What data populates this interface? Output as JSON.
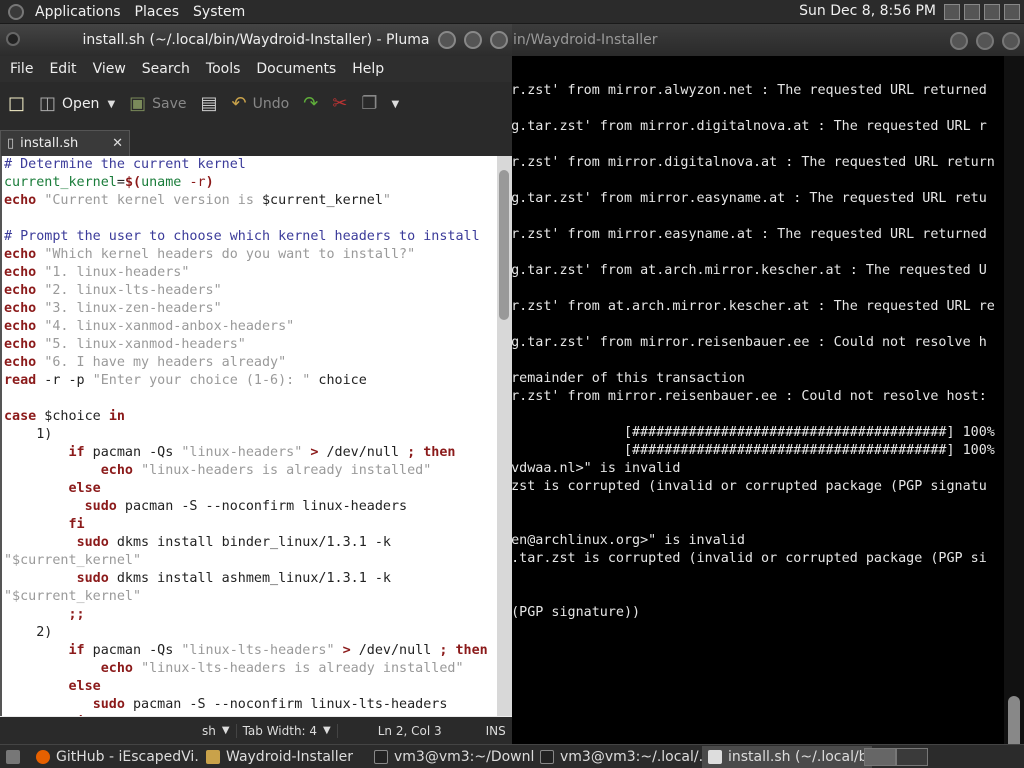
{
  "topbar": {
    "menus": [
      "Applications",
      "Places",
      "System"
    ],
    "clock": "Sun Dec  8,  8:56 PM"
  },
  "terminal": {
    "title": "in/Waydroid-Installer",
    "lines": [
      "tar.zst' from mirror.alwyzon.net : The requested URL returned",
      "",
      "pkg.tar.zst' from mirror.digitalnova.at : The requested URL r",
      "",
      "tar.zst' from mirror.digitalnova.at : The requested URL return",
      "",
      "pkg.tar.zst' from mirror.easyname.at : The requested URL retu",
      "",
      "tar.zst' from mirror.easyname.at : The requested URL returned",
      "",
      "pkg.tar.zst' from at.arch.mirror.kescher.at : The requested U",
      "",
      "tar.zst' from at.arch.mirror.kescher.at : The requested URL re",
      "",
      "pkg.tar.zst' from mirror.reisenbauer.ee : Could not resolve h",
      "",
      "e remainder of this transaction",
      "tar.zst' from mirror.reisenbauer.ee : Could not resolve host:",
      "",
      "                [#######################################] 100%",
      "                [#######################################] 100%",
      "e@vdwaa.nl>\" is invalid",
      "r.zst is corrupted (invalid or corrupted package (PGP signatu",
      "",
      "",
      "yzen@archlinux.org>\" is invalid",
      "kg.tar.zst is corrupted (invalid or corrupted package (PGP si",
      "",
      "",
      "e (PGP signature))"
    ]
  },
  "pluma": {
    "title": "install.sh (~/.local/bin/Waydroid-Installer) - Pluma",
    "menus": [
      "File",
      "Edit",
      "View",
      "Search",
      "Tools",
      "Documents",
      "Help"
    ],
    "toolbar": {
      "open": "Open",
      "save": "Save",
      "undo": "Undo"
    },
    "tab": "install.sh",
    "status": {
      "lang": "sh",
      "tabwidth": "Tab Width:  4",
      "position": "Ln 2, Col 3",
      "mode": "INS"
    }
  },
  "code": [
    [
      [
        "c-cm",
        "# Determine the current kernel"
      ]
    ],
    [
      [
        "c-var",
        "current_kernel"
      ],
      [
        "c-def",
        "="
      ],
      [
        "c-kw",
        "$("
      ],
      [
        "c-var",
        "uname"
      ],
      [
        "c-def",
        " "
      ],
      [
        "c-op",
        "-r"
      ],
      [
        "c-kw",
        ")"
      ]
    ],
    [
      [
        "c-kw",
        "echo"
      ],
      [
        "c-def",
        " "
      ],
      [
        "c-str",
        "\"Current kernel version is "
      ],
      [
        "c-def",
        "$current_kernel"
      ],
      [
        "c-str",
        "\""
      ]
    ],
    [
      [
        "c-def",
        ""
      ]
    ],
    [
      [
        "c-cm",
        "# Prompt the user to choose which kernel headers to install"
      ]
    ],
    [
      [
        "c-kw",
        "echo"
      ],
      [
        "c-def",
        " "
      ],
      [
        "c-str",
        "\"Which kernel headers do you want to install?\""
      ]
    ],
    [
      [
        "c-kw",
        "echo"
      ],
      [
        "c-def",
        " "
      ],
      [
        "c-str",
        "\"1. linux-headers\""
      ]
    ],
    [
      [
        "c-kw",
        "echo"
      ],
      [
        "c-def",
        " "
      ],
      [
        "c-str",
        "\"2. linux-lts-headers\""
      ]
    ],
    [
      [
        "c-kw",
        "echo"
      ],
      [
        "c-def",
        " "
      ],
      [
        "c-str",
        "\"3. linux-zen-headers\""
      ]
    ],
    [
      [
        "c-kw",
        "echo"
      ],
      [
        "c-def",
        " "
      ],
      [
        "c-str",
        "\"4. linux-xanmod-anbox-headers\""
      ]
    ],
    [
      [
        "c-kw",
        "echo"
      ],
      [
        "c-def",
        " "
      ],
      [
        "c-str",
        "\"5. linux-xanmod-headers\""
      ]
    ],
    [
      [
        "c-kw",
        "echo"
      ],
      [
        "c-def",
        " "
      ],
      [
        "c-str",
        "\"6. I have my headers already\""
      ]
    ],
    [
      [
        "c-kw",
        "read"
      ],
      [
        "c-def",
        " -r -p "
      ],
      [
        "c-str",
        "\"Enter your choice (1-6): \""
      ],
      [
        "c-def",
        " choice"
      ]
    ],
    [
      [
        "c-def",
        ""
      ]
    ],
    [
      [
        "c-kw",
        "case"
      ],
      [
        "c-def",
        " $choice "
      ],
      [
        "c-kw",
        "in"
      ]
    ],
    [
      [
        "c-def",
        "    1)"
      ]
    ],
    [
      [
        "c-def",
        "        "
      ],
      [
        "c-kw",
        "if"
      ],
      [
        "c-def",
        " pacman -Qs "
      ],
      [
        "c-str",
        "\"linux-headers\""
      ],
      [
        "c-def",
        " "
      ],
      [
        "c-kw",
        ">"
      ],
      [
        "c-def",
        " /dev/null "
      ],
      [
        "c-kw",
        "; then"
      ]
    ],
    [
      [
        "c-def",
        "            "
      ],
      [
        "c-kw",
        "echo"
      ],
      [
        "c-def",
        " "
      ],
      [
        "c-str",
        "\"linux-headers is already installed\""
      ]
    ],
    [
      [
        "c-def",
        "        "
      ],
      [
        "c-kw",
        "else"
      ]
    ],
    [
      [
        "c-def",
        "          "
      ],
      [
        "c-kw",
        "sudo"
      ],
      [
        "c-def",
        " pacman -S --noconfirm linux-headers"
      ]
    ],
    [
      [
        "c-def",
        "        "
      ],
      [
        "c-kw",
        "fi"
      ]
    ],
    [
      [
        "c-def",
        "         "
      ],
      [
        "c-kw",
        "sudo"
      ],
      [
        "c-def",
        " dkms install binder_linux/1.3.1 -k"
      ]
    ],
    [
      [
        "c-str",
        "\"$current_kernel\""
      ]
    ],
    [
      [
        "c-def",
        "         "
      ],
      [
        "c-kw",
        "sudo"
      ],
      [
        "c-def",
        " dkms install ashmem_linux/1.3.1 -k"
      ]
    ],
    [
      [
        "c-str",
        "\"$current_kernel\""
      ]
    ],
    [
      [
        "c-def",
        "        "
      ],
      [
        "c-kw",
        ";;"
      ]
    ],
    [
      [
        "c-def",
        "    2)"
      ]
    ],
    [
      [
        "c-def",
        "        "
      ],
      [
        "c-kw",
        "if"
      ],
      [
        "c-def",
        " pacman -Qs "
      ],
      [
        "c-str",
        "\"linux-lts-headers\""
      ],
      [
        "c-def",
        " "
      ],
      [
        "c-kw",
        ">"
      ],
      [
        "c-def",
        " /dev/null "
      ],
      [
        "c-kw",
        "; then"
      ]
    ],
    [
      [
        "c-def",
        "            "
      ],
      [
        "c-kw",
        "echo"
      ],
      [
        "c-def",
        " "
      ],
      [
        "c-str",
        "\"linux-lts-headers is already installed\""
      ]
    ],
    [
      [
        "c-def",
        "        "
      ],
      [
        "c-kw",
        "else"
      ]
    ],
    [
      [
        "c-def",
        "           "
      ],
      [
        "c-kw",
        "sudo"
      ],
      [
        "c-def",
        " pacman -S --noconfirm linux-lts-headers"
      ]
    ],
    [
      [
        "c-def",
        "        "
      ],
      [
        "c-kw",
        "fi"
      ]
    ]
  ],
  "taskbar": [
    {
      "label": "GitHub - iEscapedVi...",
      "icon": "firefox-icon"
    },
    {
      "label": "Waydroid-Installer",
      "icon": "folder-icon"
    },
    {
      "label": "vm3@vm3:~/Downl...",
      "icon": "terminal-icon"
    },
    {
      "label": "vm3@vm3:~/.local/...",
      "icon": "terminal-icon"
    },
    {
      "label": "install.sh (~/.local/bi...",
      "icon": "pluma-icon"
    }
  ]
}
